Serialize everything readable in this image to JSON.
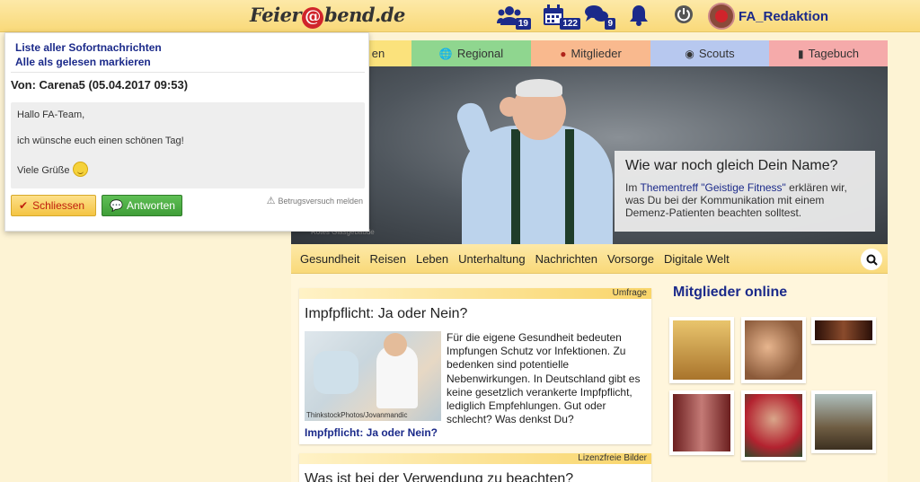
{
  "header": {
    "logo": {
      "before": "Feier",
      "at": "@",
      "after": "bend.de"
    },
    "friends_count": "19",
    "events_count": "122",
    "messages_count": "9",
    "username": "FA_Redaktion"
  },
  "tabs": [
    {
      "label": "Regional",
      "icon": "globe-icon",
      "color": "#8fd68f"
    },
    {
      "label": "Mitglieder",
      "icon": "user-icon",
      "color": "#f9b98e"
    },
    {
      "label": "Scouts",
      "icon": "eye-icon",
      "color": "#b7c8ef"
    },
    {
      "label": "Tagebuch",
      "icon": "book-icon",
      "color": "#f5aaaa"
    }
  ],
  "first_tab_partial": "en",
  "hero": {
    "credit": "Rotes Glasgebäude",
    "title": "Wie war noch gleich Dein Name?",
    "text_before": "Im ",
    "link": "Thementreff \"Geistige Fitness\"",
    "text_after": " erklären wir, was Du bei der Kommunikation mit einem Demenz-Patienten beachten solltest."
  },
  "categories": [
    "Gesundheit",
    "Reisen",
    "Leben",
    "Unterhaltung",
    "Nachrichten",
    "Vorsorge",
    "Digitale Welt"
  ],
  "article1": {
    "band": "Umfrage",
    "title": "Impfpflicht: Ja oder Nein?",
    "image_caption": "ThinkstockPhotos/Jovanmandic",
    "text": "Für die eigene Gesundheit bedeuten Impfungen Schutz vor Infektionen. Zu bedenken sind potentielle Nebenwirkungen. In Deutschland gibt es keine gesetzlich verankerte Impfpflicht, lediglich Empfehlungen. Gut oder schlecht? Was denkst Du?",
    "link": "Impfpflicht: Ja oder Nein?"
  },
  "article2": {
    "band": "Lizenzfreie Bilder",
    "title": "Was ist bei der Verwendung zu beachten?"
  },
  "online": {
    "title": "Mitglieder online"
  },
  "popup": {
    "link_all": "Liste aller Sofortnachrichten",
    "link_mark_read": "Alle als gelesen markieren",
    "from": "Von: Carena5 (05.04.2017 09:53)",
    "greeting": "Hallo FA-Team,",
    "body": "ich wünsche euch einen schönen Tag!",
    "closing": "Viele Grüße",
    "close_label": "Schliessen",
    "reply_label": "Antworten",
    "report_label": "Betrugsversuch melden"
  },
  "colors": {
    "accent_blue": "#1b2a8a",
    "header_yellow": "#f9d979",
    "close_red": "#c0200f",
    "reply_green": "#3f9e38"
  }
}
